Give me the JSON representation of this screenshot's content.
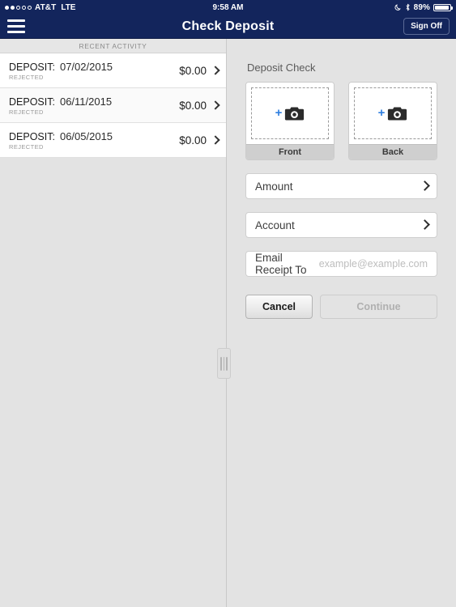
{
  "status_bar": {
    "signal_dots_filled": 2,
    "signal_dots_total": 5,
    "carrier": "AT&T",
    "network": "LTE",
    "time": "9:58 AM",
    "battery_percent": "89%",
    "dnd_icon": "moon-icon",
    "bluetooth_icon": "bluetooth-icon",
    "battery_icon": "battery-icon"
  },
  "navbar": {
    "menu_icon": "hamburger-menu-icon",
    "title": "Check Deposit",
    "sign_off_label": "Sign Off",
    "background_color": "#13255c"
  },
  "left_panel": {
    "section_header": "RECENT ACTIVITY",
    "rows": [
      {
        "label": "DEPOSIT:",
        "date": "07/02/2015",
        "status": "REJECTED",
        "amount": "$0.00"
      },
      {
        "label": "DEPOSIT:",
        "date": "06/11/2015",
        "status": "REJECTED",
        "amount": "$0.00"
      },
      {
        "label": "DEPOSIT:",
        "date": "06/05/2015",
        "status": "REJECTED",
        "amount": "$0.00"
      }
    ]
  },
  "right_panel": {
    "title": "Deposit Check",
    "captures": [
      {
        "caption": "Front",
        "plus": "+",
        "icon": "camera-icon"
      },
      {
        "caption": "Back",
        "plus": "+",
        "icon": "camera-icon"
      }
    ],
    "fields": [
      {
        "label": "Amount"
      },
      {
        "label": "Account"
      }
    ],
    "email_field": {
      "label": "Email Receipt To",
      "placeholder": "example@example.com",
      "value": ""
    },
    "buttons": {
      "cancel_label": "Cancel",
      "continue_label": "Continue",
      "continue_disabled": true
    },
    "accent_color": "#2f7fe0",
    "background_color": "#e3e3e3"
  }
}
